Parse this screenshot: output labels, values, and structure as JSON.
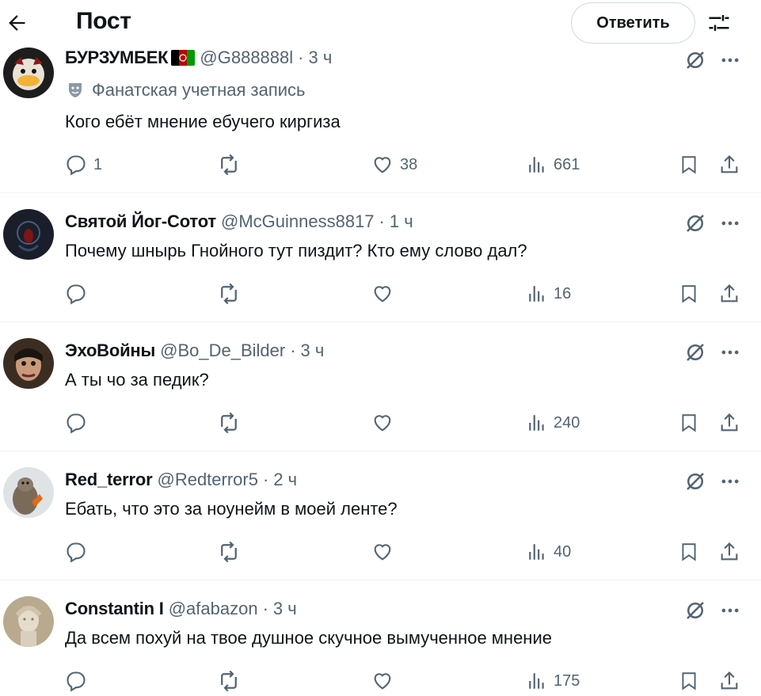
{
  "header": {
    "title": "Пост",
    "reply_label": "Ответить"
  },
  "tweets": [
    {
      "name": "БУРЗУМБЕК",
      "handle": "@G888888l",
      "time": "3 ч",
      "fan_label": "Фанатская учетная запись",
      "text": "Кого ебёт мнение ебучего киргиза",
      "replies": "1",
      "retweets": "",
      "likes": "38",
      "views": "661"
    },
    {
      "name": "Святой Йог-Сотот",
      "handle": "@McGuinness8817",
      "time": "1 ч",
      "text": "Почему шнырь Гнойного тут пиздит? Кто ему слово дал?",
      "replies": "",
      "retweets": "",
      "likes": "",
      "views": "16"
    },
    {
      "name": "ЭхоВойны",
      "handle": "@Bo_De_Bilder",
      "time": "3 ч",
      "text": "А ты чо за педик?",
      "replies": "",
      "retweets": "",
      "likes": "",
      "views": "240"
    },
    {
      "name": "Red_terror",
      "handle": "@Redterror5",
      "time": "2 ч",
      "text": "Ебать, что это за ноунейм в моей ленте?",
      "replies": "",
      "retweets": "",
      "likes": "",
      "views": "40"
    },
    {
      "name": "Constantin I",
      "handle": "@afabazon",
      "time": "3 ч",
      "text": "Да всем похуй на твое душное скучное вымученное мнение",
      "replies": "",
      "retweets": "",
      "likes": "",
      "views": "175"
    }
  ],
  "icons": {
    "back": "arrow-left-icon",
    "filter": "sliders-icon",
    "grok": "grok-icon",
    "more": "more-icon",
    "reply": "reply-icon",
    "retweet": "retweet-icon",
    "like": "heart-icon",
    "views": "views-icon",
    "bookmark": "bookmark-icon",
    "share": "share-icon"
  },
  "colors": {
    "text": "#0f1419",
    "secondary": "#536471",
    "divider": "#eff3f4",
    "border": "#cfd9de"
  }
}
